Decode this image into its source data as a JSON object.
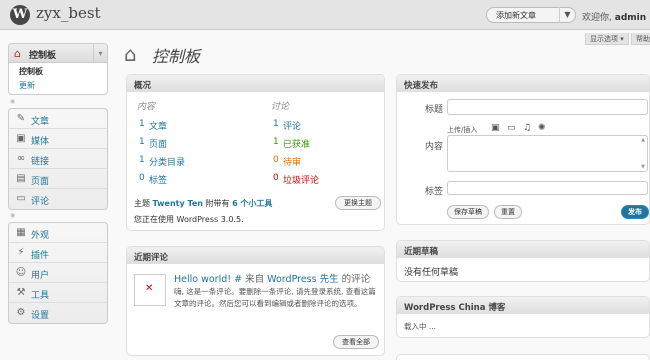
{
  "header": {
    "logo_glyph": "W",
    "site_name": "zyx_best",
    "favorite_label": "添加新文章",
    "favorite_arrow": "▼",
    "welcome": "欢迎你,",
    "username": "admin",
    "separator": "|"
  },
  "screen_tabs": {
    "options": "显示选项 ▾",
    "help": "帮助 ▾"
  },
  "sidebar": {
    "dashboard": {
      "label": "控制板",
      "icon": "home-icon",
      "arrow": "▾"
    },
    "dashboard_sub": [
      "控制板",
      "更新"
    ],
    "group1": [
      {
        "label": "文章",
        "icon": "pin-icon"
      },
      {
        "label": "媒体",
        "icon": "media-icon"
      },
      {
        "label": "链接",
        "icon": "link-icon"
      },
      {
        "label": "页面",
        "icon": "page-icon"
      },
      {
        "label": "评论",
        "icon": "comment-icon"
      }
    ],
    "group2": [
      {
        "label": "外观",
        "icon": "appearance-icon"
      },
      {
        "label": "插件",
        "icon": "plugin-icon"
      },
      {
        "label": "用户",
        "icon": "users-icon"
      },
      {
        "label": "工具",
        "icon": "tools-icon"
      },
      {
        "label": "设置",
        "icon": "settings-icon"
      }
    ]
  },
  "page": {
    "title": "控制板"
  },
  "right_now": {
    "title": "概况",
    "content_head": "内容",
    "discussion_head": "讨论",
    "content": [
      {
        "count": "1",
        "label": "文章"
      },
      {
        "count": "1",
        "label": "页面"
      },
      {
        "count": "1",
        "label": "分类目录"
      },
      {
        "count": "0",
        "label": "标签"
      }
    ],
    "discussion": [
      {
        "count": "1",
        "label": "评论"
      },
      {
        "count": "1",
        "label": "已获准"
      },
      {
        "count": "0",
        "label": "待审"
      },
      {
        "count": "0",
        "label": "垃圾评论"
      }
    ],
    "theme_prefix": "主题",
    "theme_name": "Twenty Ten",
    "theme_mid": "附带有",
    "widgets": "6 个小工具",
    "version_text": "您正在使用 WordPress 3.0.5.",
    "change_theme": "更换主题"
  },
  "recent_comments": {
    "title": "近期评论",
    "comment_link": "Hello world!",
    "comment_hash": "#",
    "comment_from": "来自",
    "comment_author": "WordPress 先生",
    "comment_of": "的评论",
    "comment_text": "嗨, 这是一条评论。要删除一条评论, 请先登录系统, 查看这篇文章的评论。然后您可以看到编辑或者删除评论的选项。",
    "view_all": "查看全部"
  },
  "quick_press": {
    "title": "快速发布",
    "title_label": "标题",
    "upload_label": "上传/插入",
    "content_label": "内容",
    "tags_label": "标签",
    "save_draft": "保存草稿",
    "reset": "重置",
    "publish": "发布"
  },
  "recent_drafts": {
    "title": "近期草稿",
    "text": "没有任何草稿"
  },
  "china_blog": {
    "title": "WordPress China 博客",
    "loading": "载入中 ..."
  }
}
